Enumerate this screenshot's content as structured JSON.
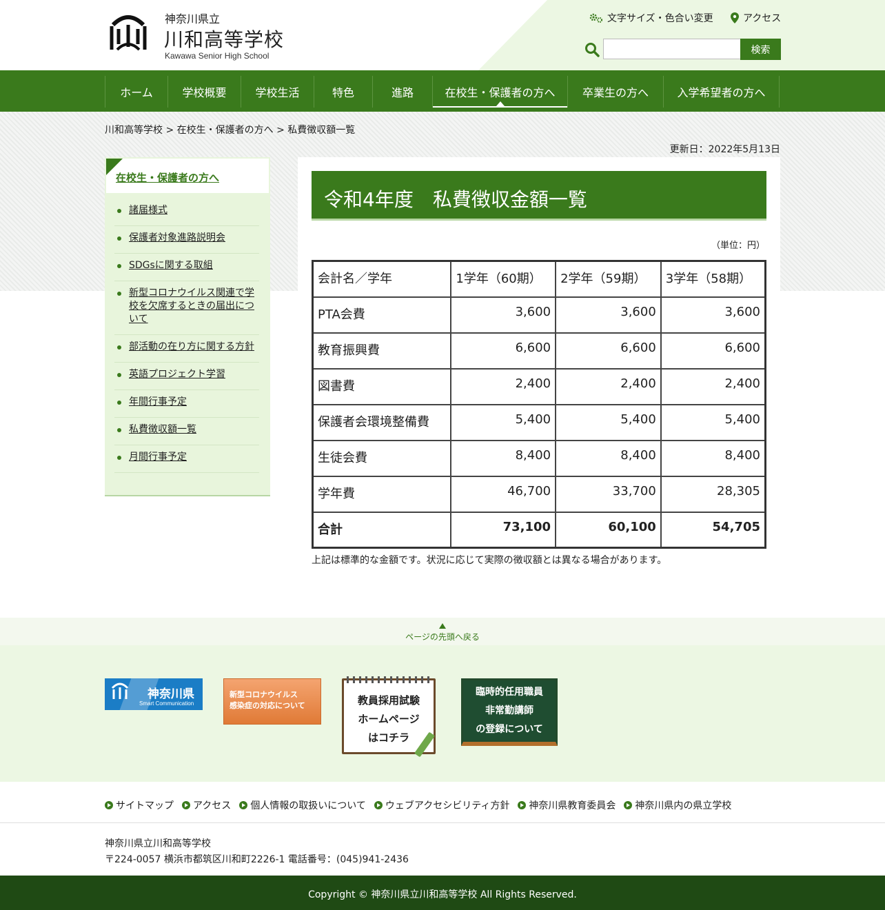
{
  "header": {
    "prefecture": "神奈川県立",
    "school_name": "川和高等学校",
    "school_name_en": "Kawawa Senior High School",
    "font_color_link": "文字サイズ・色合い変更",
    "access_link": "アクセス",
    "search_placeholder": "",
    "search_button": "検索"
  },
  "nav": {
    "items": [
      {
        "label": "ホーム"
      },
      {
        "label": "学校概要"
      },
      {
        "label": "学校生活"
      },
      {
        "label": "特色"
      },
      {
        "label": "進路"
      },
      {
        "label": "在校生・保護者の方へ"
      },
      {
        "label": "卒業生の方へ"
      },
      {
        "label": "入学希望者の方へ"
      }
    ]
  },
  "breadcrumb": "川和高等学校 > 在校生・保護者の方へ > 私費徴収額一覧",
  "updated": "更新日：2022年5月13日",
  "sidebar": {
    "title": "在校生・保護者の方へ",
    "items": [
      {
        "label": "諸届様式"
      },
      {
        "label": "保護者対象進路説明会"
      },
      {
        "label": "SDGsに関する取組"
      },
      {
        "label": "新型コロナウイルス関連で学校を欠席するときの届出について"
      },
      {
        "label": "部活動の在り方に関する方針"
      },
      {
        "label": "英語プロジェクト学習"
      },
      {
        "label": "年間行事予定"
      },
      {
        "label": "私費徴収額一覧"
      },
      {
        "label": "月間行事予定"
      }
    ]
  },
  "main": {
    "title": "令和4年度　私費徴収金額一覧",
    "unit": "（単位：円）",
    "table": {
      "header": [
        "会計名／学年",
        "1学年（60期）",
        "2学年（59期）",
        "3学年（58期）"
      ],
      "rows": [
        [
          "PTA会費",
          "3,600",
          "3,600",
          "3,600"
        ],
        [
          "教育振興費",
          "6,600",
          "6,600",
          "6,600"
        ],
        [
          "図書費",
          "2,400",
          "2,400",
          "2,400"
        ],
        [
          "保護者会環境整備費",
          "5,400",
          "5,400",
          "5,400"
        ],
        [
          "生徒会費",
          "8,400",
          "8,400",
          "8,400"
        ],
        [
          "学年費",
          "46,700",
          "33,700",
          "28,305"
        ]
      ],
      "total": [
        "合計",
        "73,100",
        "60,100",
        "54,705"
      ]
    },
    "note": "上記は標準的な金額です。状況に応じて実際の徴収額とは異なる場合があります。"
  },
  "back_to_top": "ページの先頭へ戻る",
  "banners": {
    "pref": {
      "name": "神奈川県",
      "sub": "Smart Communication"
    },
    "corona": [
      "新型コロナウイルス",
      "感染症の対応について"
    ],
    "recruit": [
      "教員採用試験",
      "ホームページ",
      "はコチラ"
    ],
    "temp": [
      "臨時的任用職員",
      "非常勤講師",
      "の登録について"
    ]
  },
  "footer": {
    "links": [
      {
        "label": "サイトマップ"
      },
      {
        "label": "アクセス"
      },
      {
        "label": "個人情報の取扱いについて"
      },
      {
        "label": "ウェブアクセシビリティ方針"
      },
      {
        "label": "神奈川県教育委員会"
      },
      {
        "label": "神奈川県内の県立学校"
      }
    ],
    "school": "神奈川県立川和高等学校",
    "address": "〒224-0057 横浜市都筑区川和町2226-1 電話番号：(045)941-2436",
    "copyright": "Copyright © 神奈川県立川和高等学校 All Rights Reserved."
  },
  "colors": {
    "brand_green": "#3a7a1c",
    "light_green": "#ecf7e3",
    "footer_dark": "#1f4a14"
  }
}
